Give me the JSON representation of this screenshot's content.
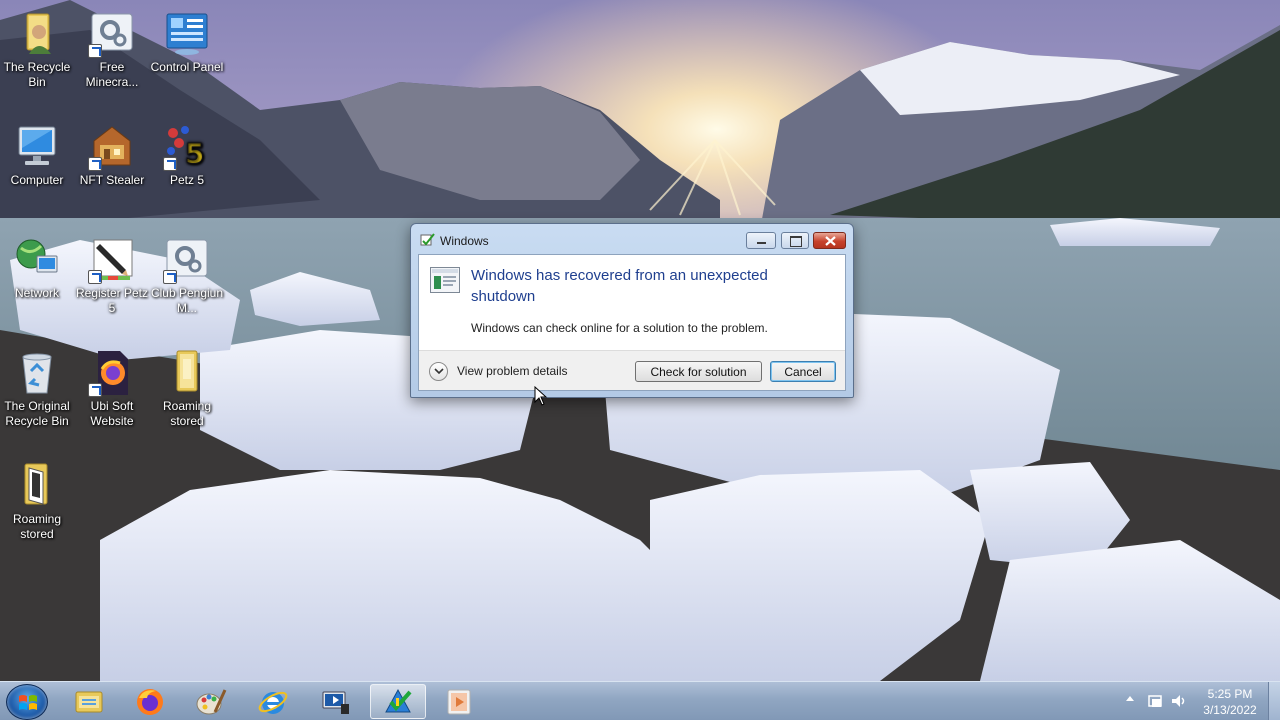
{
  "desktop": {
    "icons": [
      {
        "label": "The Recycle Bin",
        "icon": "folder-user-icon"
      },
      {
        "label": "Free Minecra...",
        "icon": "settings-shortcut-icon"
      },
      {
        "label": "Control Panel",
        "icon": "control-panel-icon"
      },
      {
        "label": "Computer",
        "icon": "computer-icon"
      },
      {
        "label": "NFT Stealer",
        "icon": "nft-stealer-icon"
      },
      {
        "label": "Petz 5",
        "icon": "petz5-icon"
      },
      {
        "label": "Network",
        "icon": "network-icon"
      },
      {
        "label": "Register Petz 5",
        "icon": "register-pen-icon"
      },
      {
        "label": "Club Pengiun M...",
        "icon": "settings-shortcut-icon"
      },
      {
        "label": "The Original Recycle Bin",
        "icon": "recycle-bin-icon"
      },
      {
        "label": "Ubi Soft Website",
        "icon": "firefox-doc-icon"
      },
      {
        "label": "Roaming stored",
        "icon": "folder-icon"
      },
      {
        "label": "Roaming stored",
        "icon": "folder-door-icon"
      }
    ]
  },
  "dialog": {
    "title": "Windows",
    "heading": "Windows has recovered from an unexpected shutdown",
    "description": "Windows can check online for a solution to the problem.",
    "details_label": "View problem details",
    "check_button": "Check for solution",
    "cancel_button": "Cancel"
  },
  "taskbar": {
    "pinned": [
      "file-explorer-icon",
      "firefox-icon",
      "paint-icon",
      "internet-explorer-icon",
      "windows-media-center-icon",
      "problem-reports-icon",
      "media-player-icon"
    ],
    "active_item": "problem-reports-icon",
    "clock": {
      "time": "5:25 PM",
      "date": "3/13/2022"
    }
  },
  "colors": {
    "heading_blue": "#1f3f8f",
    "taskbar": "#90a6c2",
    "close_red": "#c7432c"
  }
}
